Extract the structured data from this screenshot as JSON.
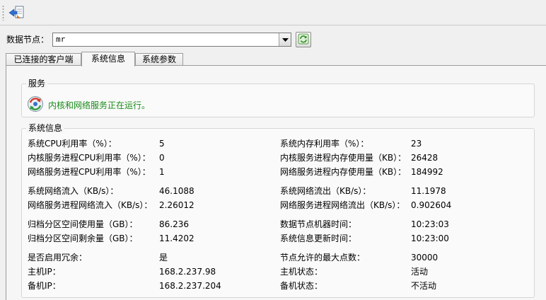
{
  "toolbar": {
    "app_icon": "export-icon"
  },
  "node": {
    "label": "数据节点：",
    "selected": "mr"
  },
  "tabs": [
    {
      "label": "已连接的客户端"
    },
    {
      "label": "系统信息"
    },
    {
      "label": "系统参数"
    }
  ],
  "service": {
    "title": "服务",
    "status_text": "内核和网络服务正在运行。",
    "status_color": "#1a8a1a"
  },
  "sysinfo": {
    "title": "系统信息",
    "left": [
      {
        "label": "系统CPU利用率（%）：",
        "value": "5"
      },
      {
        "label": "内核服务进程CPU利用率（%）：",
        "value": "0"
      },
      {
        "label": "网络服务进程CPU利用率（%）：",
        "value": "1"
      },
      {
        "label": "系统网络流入（KB/s）：",
        "value": "46.1088"
      },
      {
        "label": "网络服务进程网络流入（KB/s）：",
        "value": "2.26012"
      },
      {
        "label": "归档分区空间使用量（GB）：",
        "value": "86.236"
      },
      {
        "label": "归档分区空间剩余量（GB）：",
        "value": "11.4202"
      },
      {
        "label": "是否启用冗余：",
        "value": "是"
      },
      {
        "label": "主机IP：",
        "value": "168.2.237.98"
      },
      {
        "label": "备机IP：",
        "value": "168.2.237.204"
      }
    ],
    "right": [
      {
        "label": "系统内存利用率（%）：",
        "value": "23"
      },
      {
        "label": "内核服务进程内存使用量（KB）：",
        "value": "26428"
      },
      {
        "label": "网络服务进程内存使用量（KB）：",
        "value": "184992"
      },
      {
        "label": "系统网络流出（KB/s）：",
        "value": "11.1978"
      },
      {
        "label": "网络服务进程网络流出（KB/s）：",
        "value": "0.902604"
      },
      {
        "label": "数据节点机器时间：",
        "value": "10:23:03"
      },
      {
        "label": "系统信息更新时间：",
        "value": "10:23:00"
      },
      {
        "label": "节点允许的最大点数：",
        "value": "30000"
      },
      {
        "label": "主机状态：",
        "value": "活动"
      },
      {
        "label": "备机状态：",
        "value": "不活动"
      }
    ]
  }
}
